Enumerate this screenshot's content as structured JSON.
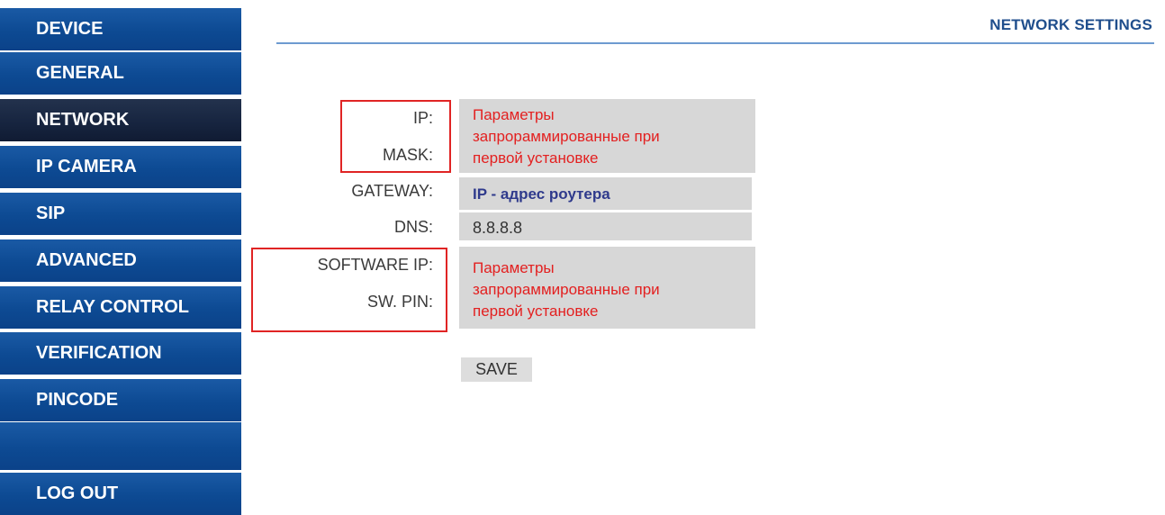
{
  "sidebar": {
    "items": [
      {
        "label": "DEVICE"
      },
      {
        "label": "GENERAL"
      },
      {
        "label": "NETWORK",
        "active": true
      },
      {
        "label": "IP CAMERA"
      },
      {
        "label": "SIP"
      },
      {
        "label": "ADVANCED"
      },
      {
        "label": "RELAY CONTROL"
      },
      {
        "label": "VERIFICATION"
      },
      {
        "label": "PINCODE"
      }
    ],
    "logout": "LOG OUT"
  },
  "header": {
    "title": "NETWORK SETTINGS"
  },
  "form": {
    "ip_label": "IP:",
    "mask_label": "MASK:",
    "gateway_label": "GATEWAY:",
    "dns_label": "DNS:",
    "software_ip_label": "SOFTWARE IP:",
    "sw_pin_label": "SW. PIN:",
    "ip_mask_note": [
      "Параметры",
      "запрораммированные при",
      "первой установке"
    ],
    "gateway_value": "IP - адрес роутера",
    "dns_value": "8.8.8.8",
    "software_note": [
      "Параметры",
      "запрораммированные при",
      "первой установке"
    ],
    "save_label": "SAVE"
  },
  "colors": {
    "nav_blue": "#0d4a93",
    "nav_active": "#172540",
    "title_blue": "#1f4e8c",
    "annotation_red": "#e02424",
    "field_gray": "#d7d7d7"
  }
}
